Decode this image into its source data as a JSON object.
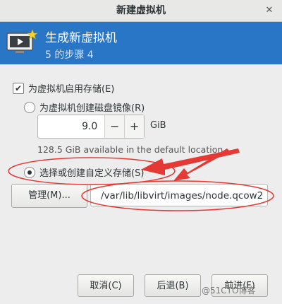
{
  "window": {
    "title": "新建虚拟机"
  },
  "header": {
    "title": "生成新虚拟机",
    "step": "5 的步骤 4"
  },
  "storage": {
    "enable_label": "为虚拟机启用存储(E)",
    "enable_checked": true,
    "create_image_label": "为虚拟机创建磁盘镜像(R)",
    "size_value": "9.0",
    "decrement_label": "−",
    "increment_label": "+",
    "unit": "GiB",
    "available_text": "128.5 GiB available in the default location",
    "custom_label": "选择或创建自定义存储(S)",
    "custom_selected": true,
    "manage_label": "管理(M)...",
    "path_value": "/var/lib/libvirt/images/node.qcow2"
  },
  "footer": {
    "cancel_label": "取消(C)",
    "back_label": "后退(B)",
    "forward_label": "前进(F)"
  },
  "watermark": "@51CTO博客",
  "colors": {
    "header_bg": "#2a76c6",
    "annotation": "#e53935"
  }
}
